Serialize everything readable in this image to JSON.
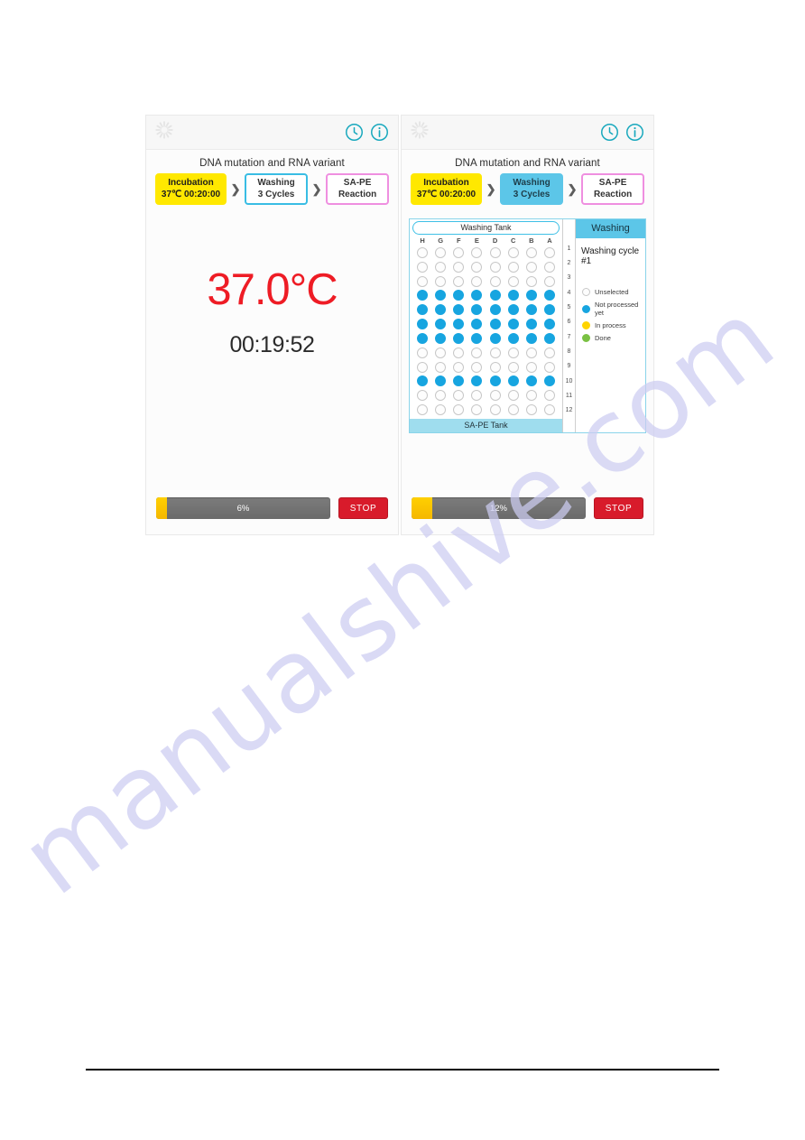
{
  "document": {
    "watermark_text": "manualshive.com"
  },
  "screens": [
    {
      "id": "incubation-screen",
      "statusbar": {
        "spinner_icon": "spinner-icon",
        "clock_icon": "clock-icon",
        "info_icon": "info-icon"
      },
      "assay_title": "DNA mutation and RNA variant",
      "steps": [
        {
          "line1": "Incubation",
          "line2": "37℃ 00:20:00",
          "state": "active",
          "style": "incubation"
        },
        {
          "line1": "Washing",
          "line2": "3 Cycles",
          "state": "idle",
          "style": "washing-idle"
        },
        {
          "line1": "SA-PE",
          "line2": "Reaction",
          "state": "idle",
          "style": "sape"
        }
      ],
      "separator_glyph": "❯",
      "view": "temperature",
      "temperature": {
        "value": "37.0°C",
        "timer": "00:19:52",
        "color": "#ee1c25"
      },
      "footer": {
        "progress_percent": 6,
        "progress_label": "6%",
        "stop_label": "STOP",
        "stop_color": "#d81b2b"
      }
    },
    {
      "id": "washing-screen",
      "statusbar": {
        "spinner_icon": "spinner-icon",
        "clock_icon": "clock-icon",
        "info_icon": "info-icon"
      },
      "assay_title": "DNA mutation and RNA variant",
      "steps": [
        {
          "line1": "Incubation",
          "line2": "37℃ 00:20:00",
          "state": "done",
          "style": "incubation"
        },
        {
          "line1": "Washing",
          "line2": "3 Cycles",
          "state": "active",
          "style": "washing-active"
        },
        {
          "line1": "SA-PE",
          "line2": "Reaction",
          "state": "idle",
          "style": "sape"
        }
      ],
      "separator_glyph": "❯",
      "view": "plate",
      "plate": {
        "top_tank_label": "Washing Tank",
        "bottom_tank_label": "SA-PE Tank",
        "column_headers": [
          "H",
          "G",
          "F",
          "E",
          "D",
          "C",
          "B",
          "A"
        ],
        "row_numbers": [
          "1",
          "2",
          "3",
          "4",
          "5",
          "6",
          "7",
          "8",
          "9",
          "10",
          "11",
          "12"
        ],
        "well_states": [
          [
            "unselected",
            "unselected",
            "unselected",
            "unselected",
            "unselected",
            "unselected",
            "unselected",
            "unselected"
          ],
          [
            "unselected",
            "unselected",
            "unselected",
            "unselected",
            "unselected",
            "unselected",
            "unselected",
            "unselected"
          ],
          [
            "unselected",
            "unselected",
            "unselected",
            "unselected",
            "unselected",
            "unselected",
            "unselected",
            "unselected"
          ],
          [
            "pending",
            "pending",
            "pending",
            "pending",
            "pending",
            "pending",
            "pending",
            "pending"
          ],
          [
            "pending",
            "pending",
            "pending",
            "pending",
            "pending",
            "pending",
            "pending",
            "pending"
          ],
          [
            "pending",
            "pending",
            "pending",
            "pending",
            "pending",
            "pending",
            "pending",
            "pending"
          ],
          [
            "pending",
            "pending",
            "pending",
            "pending",
            "pending",
            "pending",
            "pending",
            "pending"
          ],
          [
            "unselected",
            "unselected",
            "unselected",
            "unselected",
            "unselected",
            "unselected",
            "unselected",
            "unselected"
          ],
          [
            "unselected",
            "unselected",
            "unselected",
            "unselected",
            "unselected",
            "unselected",
            "unselected",
            "unselected"
          ],
          [
            "pending",
            "pending",
            "pending",
            "pending",
            "pending",
            "pending",
            "pending",
            "pending"
          ],
          [
            "unselected",
            "unselected",
            "unselected",
            "unselected",
            "unselected",
            "unselected",
            "unselected",
            "unselected"
          ],
          [
            "unselected",
            "unselected",
            "unselected",
            "unselected",
            "unselected",
            "unselected",
            "unselected",
            "unselected"
          ]
        ]
      },
      "panel": {
        "header": "Washing",
        "cycle_text": "Washing cycle #1",
        "legend": [
          {
            "label": "Unselected",
            "state": "unselected",
            "color": "#fdfdfd"
          },
          {
            "label": "Not processed yet",
            "state": "pending",
            "color": "#17a5e0"
          },
          {
            "label": "In process",
            "state": "inprocess",
            "color": "#ffd400"
          },
          {
            "label": "Done",
            "state": "done",
            "color": "#7ac143"
          }
        ]
      },
      "footer": {
        "progress_percent": 12,
        "progress_label": "12%",
        "stop_label": "STOP",
        "stop_color": "#d81b2b"
      }
    }
  ]
}
